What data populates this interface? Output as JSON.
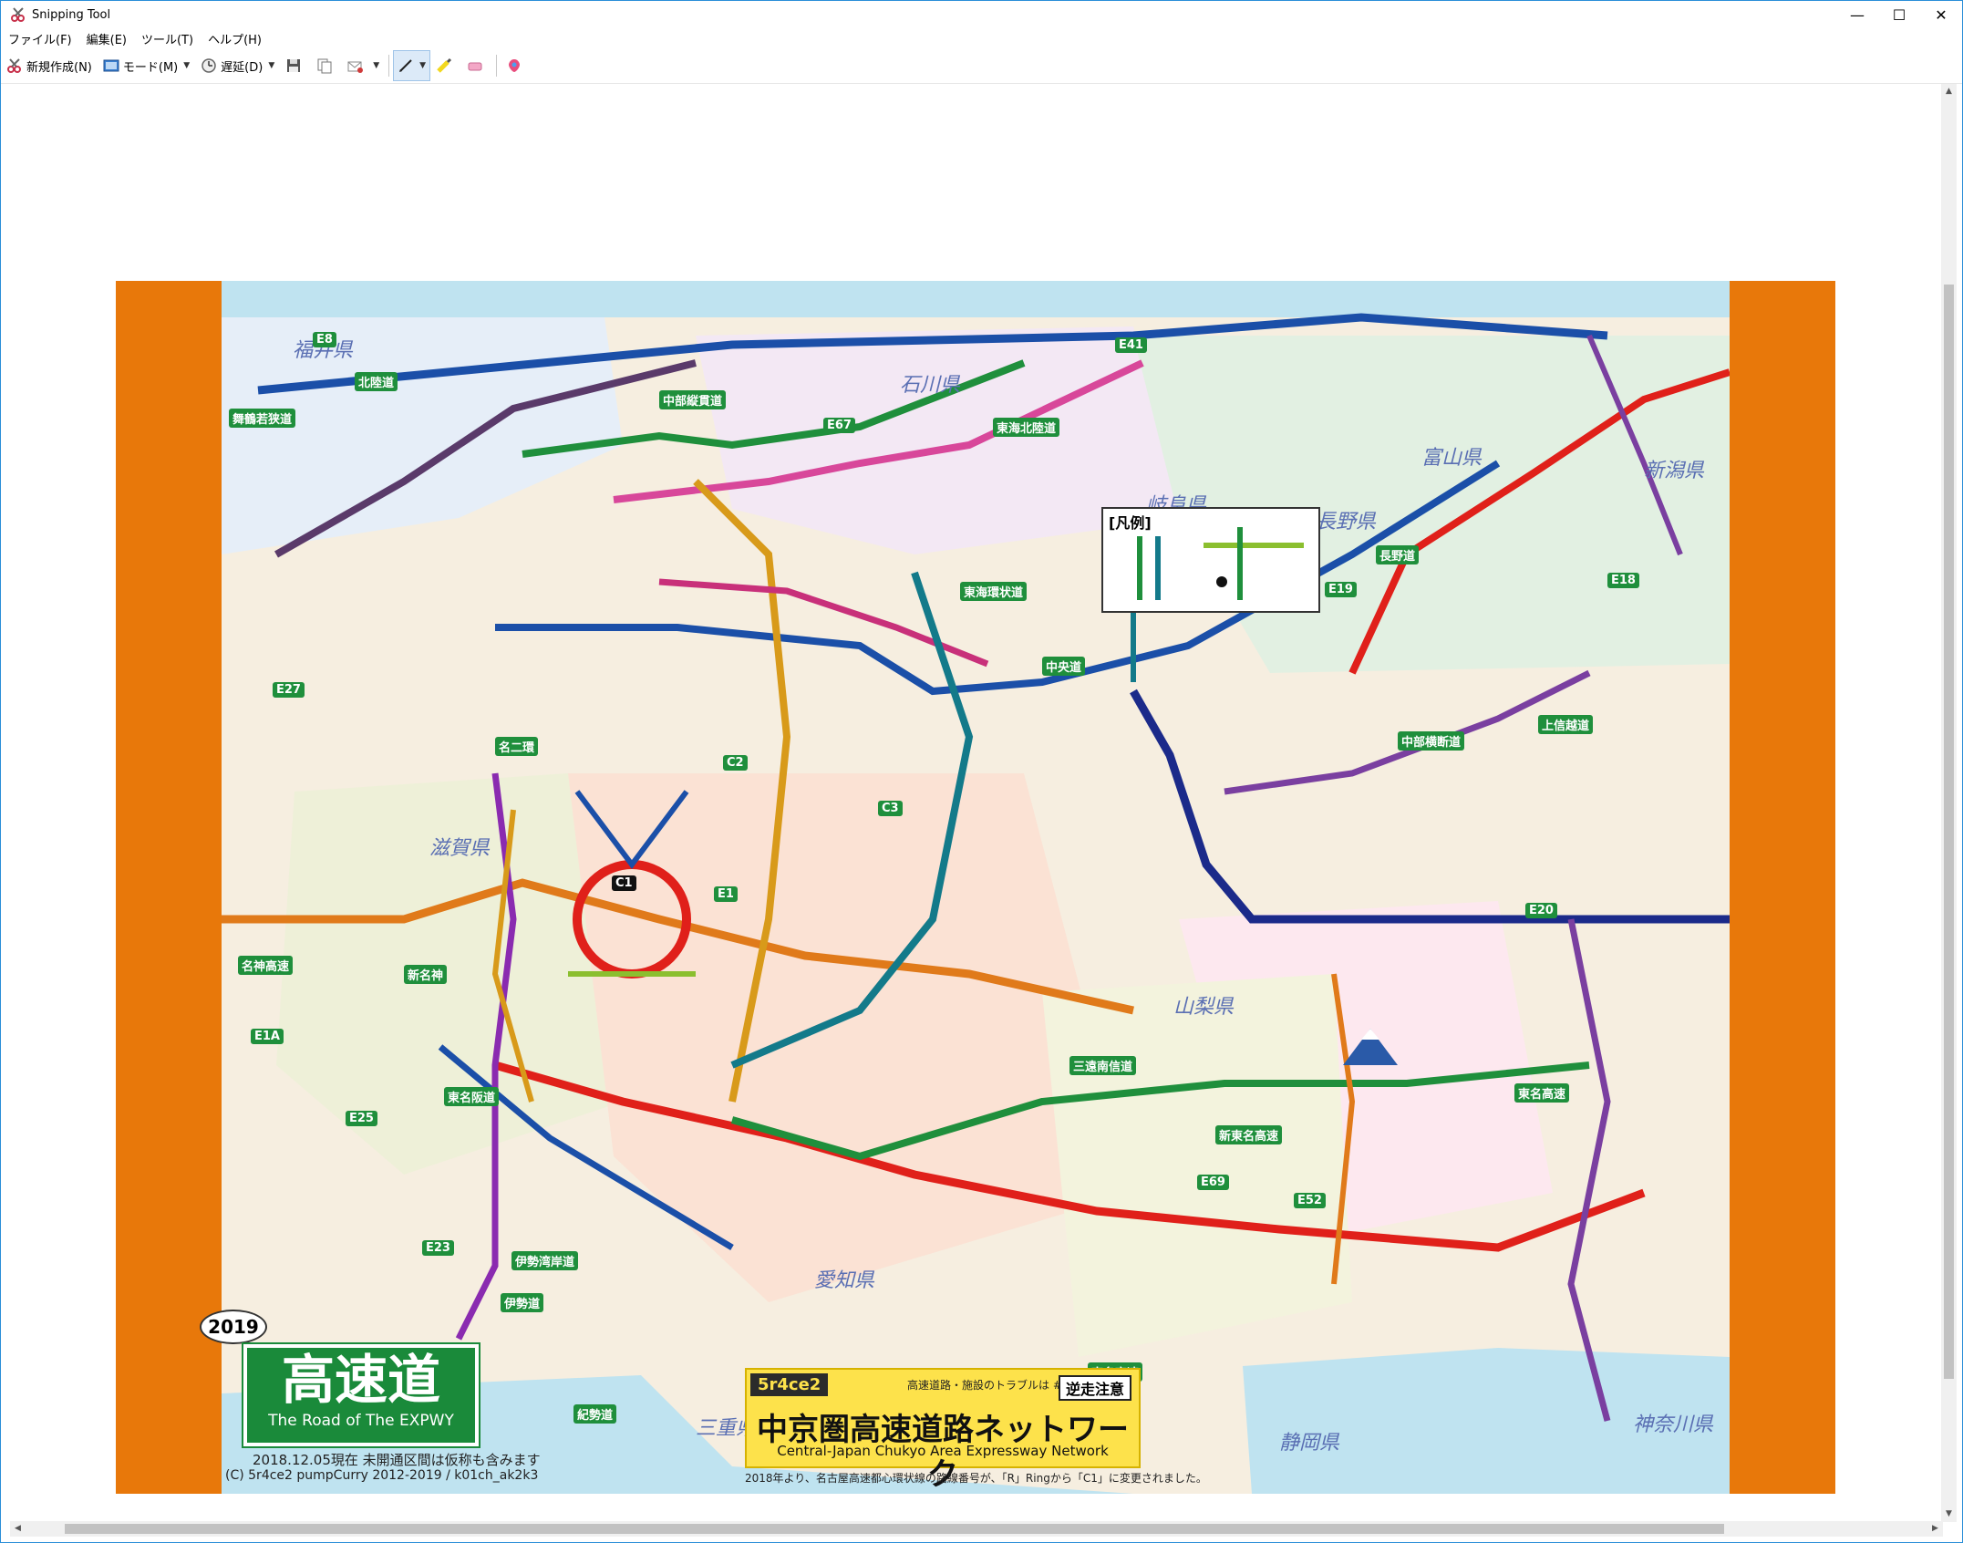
{
  "window": {
    "title": "Snipping Tool",
    "controls": {
      "minimize": "—",
      "maximize": "☐",
      "close": "✕"
    }
  },
  "menu": [
    "ファイル(F)",
    "編集(E)",
    "ツール(T)",
    "ヘルプ(H)"
  ],
  "toolbar": {
    "new_label": "新規作成(N)",
    "mode_label": "モード(M)",
    "delay_label": "遅延(D)",
    "icons": [
      "scissors-icon",
      "mode-icon",
      "clock-icon",
      "save-icon",
      "copy-icon",
      "send-icon",
      "pen-icon",
      "highlighter-icon",
      "eraser-icon",
      "paint3d-icon"
    ]
  },
  "map": {
    "brand": "5r4ce2",
    "trouble_text": "高速道路・施設のトラブルは #9910",
    "warning_badge": "逆走注意",
    "title_jp": "中京圏高速道路ネットワーク",
    "title_en": "Central-Japan Chukyo Area Expressway Network",
    "footnote": "2018年より、名古屋高速都心環状線の路線番号が、「R」Ringから「C1」に変更されました。",
    "logo_big": "高速道",
    "logo_sub": "The Road of The EXPWY",
    "year": "2019",
    "date_note": "2018.12.05現在 未開通区間は仮称も含みます",
    "copyright": "(C) 5r4ce2 pumpCurry 2012-2019 / k01ch_ak2k3",
    "legend_title": "[凡例]",
    "prefectures": [
      "福井県",
      "石川県",
      "富山県",
      "新潟県",
      "岐阜県",
      "長野県",
      "滋賀県",
      "愛知県",
      "三重県",
      "静岡県",
      "山梨県",
      "神奈川県"
    ],
    "routes": [
      "北陸道",
      "中部縦貫道",
      "東海北陸道",
      "東海環状道",
      "中央道",
      "長野道",
      "上信越道",
      "名神高速",
      "新名神",
      "東名高速",
      "新東名高速",
      "伊勢湾岸道",
      "東名阪道",
      "伊勢道",
      "紀勢道",
      "中部横断道",
      "三遠南信道",
      "舞鶴若狭道",
      "名二環",
      "東名高速"
    ],
    "route_codes": [
      "E8",
      "E41",
      "E67",
      "E19",
      "E20",
      "E1",
      "E1A",
      "E23",
      "E25",
      "E52",
      "E69",
      "E18",
      "E27",
      "C1",
      "C2",
      "C3"
    ],
    "colors": {
      "frame": "#e8780a",
      "mapbg": "#f6eee0",
      "sea": "#bfe3f0",
      "expwy_green": "#1f8f3c",
      "pa_pink": "#e0307a",
      "logo_green": "#1a8a3a",
      "title_yellow": "#fde24b"
    }
  }
}
